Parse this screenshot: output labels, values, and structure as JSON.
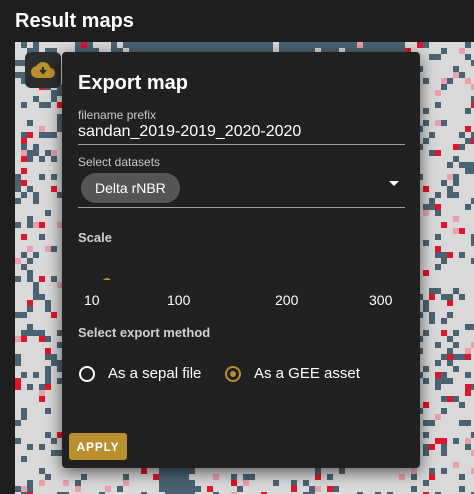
{
  "panel": {
    "title": "Result maps"
  },
  "icons": {
    "export": "cloud-download-icon"
  },
  "colors": {
    "accent": "#b8912e",
    "map_water": "#4b6272",
    "map_land": "#d9d9d9",
    "map_burn": "#e0142a"
  },
  "dialog": {
    "title": "Export map",
    "filename": {
      "label": "filename prefix",
      "value": "sandan_2019-2019_2020-2020"
    },
    "datasets": {
      "label": "Select datasets",
      "selected": [
        "Delta rNBR"
      ]
    },
    "scale": {
      "label": "Scale",
      "min": 10,
      "max": 300,
      "value": 10,
      "ticks": [
        "10",
        "100",
        "200",
        "300"
      ]
    },
    "export_method": {
      "label": "Select export method",
      "options": [
        {
          "label": "As a sepal file",
          "selected": false
        },
        {
          "label": "As a GEE asset",
          "selected": true
        }
      ]
    },
    "apply_label": "APPLY"
  }
}
